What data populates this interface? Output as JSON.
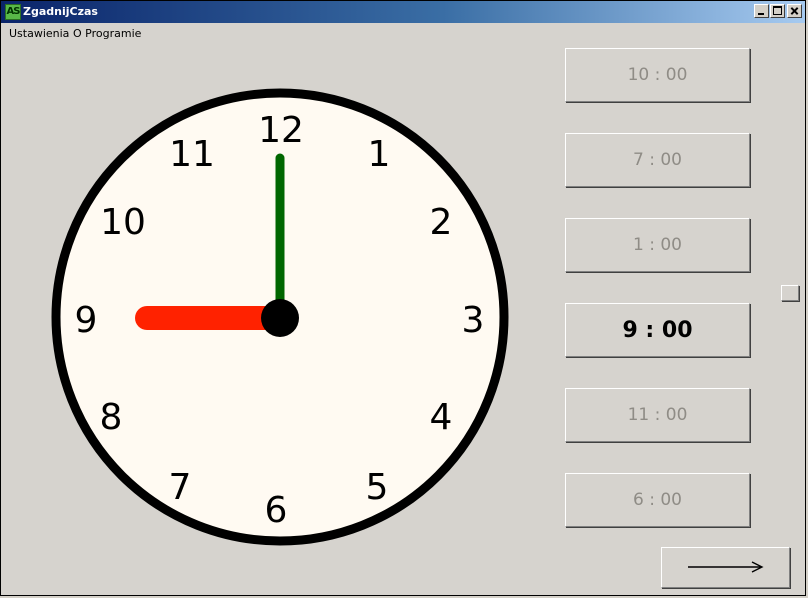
{
  "window": {
    "title": "ZgadnijCzas",
    "icon_text": "AS"
  },
  "menu": {
    "items": [
      "Ustawienia",
      "O Programie"
    ]
  },
  "clock": {
    "numbers": [
      "12",
      "1",
      "2",
      "3",
      "4",
      "5",
      "6",
      "7",
      "8",
      "9",
      "10",
      "11"
    ],
    "shown_time": "9:00",
    "hour_hand_color": "#ff2200",
    "minute_hand_color": "#006600",
    "face_color": "#fffaf2"
  },
  "answers": [
    {
      "label": "10 : 00",
      "selected": false
    },
    {
      "label": "7 : 00",
      "selected": false
    },
    {
      "label": "1 : 00",
      "selected": false
    },
    {
      "label": "9 : 00",
      "selected": true
    },
    {
      "label": "11 : 00",
      "selected": false
    },
    {
      "label": "6 : 00",
      "selected": false
    }
  ],
  "next_button": {
    "icon": "arrow-right-icon"
  }
}
